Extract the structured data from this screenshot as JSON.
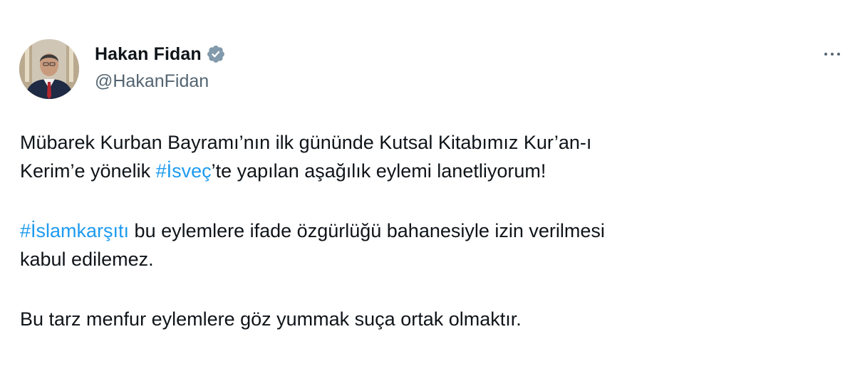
{
  "author": {
    "display_name": "Hakan Fidan",
    "handle": "@HakanFidan",
    "verified_icon": "verified-badge-icon"
  },
  "more_icon": "more-horizontal-icon",
  "tweet": {
    "p1_line1": "Mübarek Kurban Bayramı’nın ilk gününde Kutsal Kitabımız Kur’an-ı",
    "p1_line2_a": "Kerim’e yönelik ",
    "p1_hashtag": "#İsveç",
    "p1_line2_b": "’te yapılan aşağılık eylemi lanetliyorum!",
    "p2_hashtag": "#İslamkarşıtı",
    "p2_line1_b": " bu eylemlere ifade özgürlüğü bahanesiyle izin verilmesi",
    "p2_line2": "kabul edilemez.",
    "p3_line1": "Bu tarz menfur eylemlere göz yummak suça ortak olmaktır."
  },
  "colors": {
    "link": "#1d9bf0",
    "secondary_text": "#536471",
    "primary_text": "#0f1419",
    "verified": "#829aab"
  }
}
